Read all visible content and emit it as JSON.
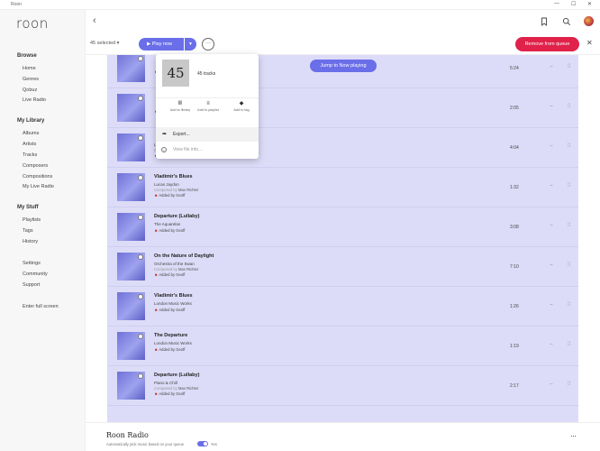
{
  "window": {
    "title": "Roon",
    "controls": [
      "—",
      "☐",
      "✕"
    ]
  },
  "app": {
    "logo": "roon"
  },
  "sidebar": {
    "sections": [
      {
        "heading": "Browse",
        "items": [
          "Home",
          "Genres",
          "Qobuz",
          "Live Radio"
        ]
      },
      {
        "heading": "My Library",
        "items": [
          "Albums",
          "Artists",
          "Tracks",
          "Composers",
          "Compositions",
          "My Live Radio"
        ]
      },
      {
        "heading": "My Stuff",
        "items": [
          "Playlists",
          "Tags",
          "History"
        ]
      },
      {
        "heading": "",
        "items": [
          "Settings",
          "Community",
          "Support"
        ]
      },
      {
        "heading": "",
        "items": [
          "Enter full screen"
        ]
      }
    ]
  },
  "toolbar": {
    "selected": "45 selected",
    "play_label": "Play now",
    "remove_label": "Remove from queue",
    "jump_label": "Jump to Now playing"
  },
  "popup": {
    "count_big": "45",
    "count_label": "45 tracks",
    "actions": [
      {
        "icon": "library-icon",
        "label": "Add to library"
      },
      {
        "icon": "playlist-icon",
        "label": "Add to playlist"
      },
      {
        "icon": "tag-icon",
        "label": "Add to tag"
      }
    ],
    "export_label": "Export...",
    "view_info_label": "View file info..."
  },
  "queue": [
    {
      "title": "",
      "artist": "",
      "composer_prefix": "",
      "composer": "",
      "added_by": "",
      "duration": "5:24"
    },
    {
      "title": "",
      "artist": "",
      "composer_prefix": "",
      "composer": "",
      "added_by": "",
      "duration": "2:05"
    },
    {
      "title": "",
      "artist": "Lucas Jaydon",
      "composer_prefix": "Composed by",
      "composer": "Max Richter",
      "added_by": "Added by Geoff",
      "duration": "4:04"
    },
    {
      "title": "Vladimir's Blues",
      "artist": "Lucas Jaydon",
      "composer_prefix": "Composed by",
      "composer": "Max Richter",
      "added_by": "Added by Geoff",
      "duration": "1:32"
    },
    {
      "title": "Departure (Lullaby)",
      "artist": "The Aquarelas",
      "composer_prefix": "",
      "composer": "",
      "added_by": "Added by Geoff",
      "duration": "3:08"
    },
    {
      "title": "On the Nature of Daylight",
      "artist": "Orchestra of the Swan",
      "composer_prefix": "Composed by",
      "composer": "Max Richter",
      "added_by": "Added by Geoff",
      "duration": "7:10"
    },
    {
      "title": "Vladimir's Blues",
      "artist": "London Music Works",
      "composer_prefix": "",
      "composer": "",
      "added_by": "Added by Geoff",
      "duration": "1:26"
    },
    {
      "title": "The Departure",
      "artist": "London Music Works",
      "composer_prefix": "",
      "composer": "",
      "added_by": "Added by Geoff",
      "duration": "1:19"
    },
    {
      "title": "Departure (Lullaby)",
      "artist": "Piano & Chill",
      "composer_prefix": "Composed by",
      "composer": "Max Richter",
      "added_by": "Added by Geoff",
      "duration": "2:17"
    }
  ],
  "footer": {
    "title": "Roon Radio",
    "subtitle": "Automatically pick music based on your queue",
    "toggle_label": "Yes",
    "toggle_on": true
  },
  "colors": {
    "accent": "#6a6ee8",
    "danger": "#e0214a",
    "selection_bg": "#dddcf8"
  }
}
